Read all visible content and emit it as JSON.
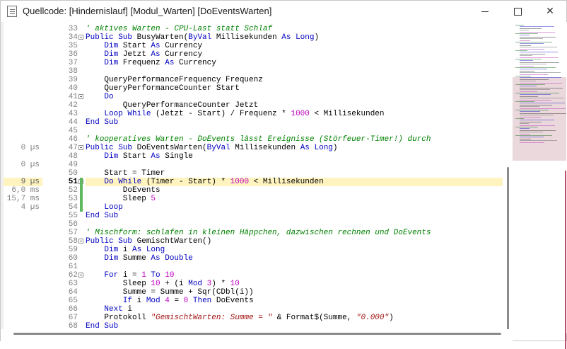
{
  "window": {
    "title": "Quellcode: [Hindernislauf]  [Modul_Warten]  [DoEventsWarten]",
    "min_icon": "minimize-icon",
    "max_icon": "maximize-icon",
    "close_icon": "close-icon",
    "close_glyph": "✕"
  },
  "timings": [
    {
      "line": 47,
      "text": "0 µs"
    },
    {
      "line": 49,
      "text": "0 µs"
    },
    {
      "line": 51,
      "text": "9 µs",
      "highlight": true
    },
    {
      "line": 52,
      "text": "6,0 ms"
    },
    {
      "line": 53,
      "text": "15,7 ms"
    },
    {
      "line": 54,
      "text": "4 µs"
    }
  ],
  "editor": {
    "first_line": 33,
    "active_line": 51,
    "lines": [
      {
        "n": "33",
        "segs": [
          [
            "cm",
            "' aktives Warten - CPU-Last statt Schlaf"
          ]
        ]
      },
      {
        "n": "34",
        "segs": [
          [
            "kw",
            "Public Sub "
          ],
          [
            "",
            "BusyWarten("
          ],
          [
            "kw",
            "ByVal "
          ],
          [
            "",
            "Millisekunden "
          ],
          [
            "kw",
            "As Long"
          ],
          [
            "",
            ")"
          ]
        ],
        "fold": true
      },
      {
        "n": "35",
        "segs": [
          [
            "",
            "    "
          ],
          [
            "kw",
            "Dim "
          ],
          [
            "",
            "Start "
          ],
          [
            "kw",
            "As "
          ],
          [
            "",
            "Currency"
          ]
        ]
      },
      {
        "n": "36",
        "segs": [
          [
            "",
            "    "
          ],
          [
            "kw",
            "Dim "
          ],
          [
            "",
            "Jetzt "
          ],
          [
            "kw",
            "As "
          ],
          [
            "",
            "Currency"
          ]
        ]
      },
      {
        "n": "37",
        "segs": [
          [
            "",
            "    "
          ],
          [
            "kw",
            "Dim "
          ],
          [
            "",
            "Frequenz "
          ],
          [
            "kw",
            "As "
          ],
          [
            "",
            "Currency"
          ]
        ]
      },
      {
        "n": "38",
        "segs": [
          [
            "",
            ""
          ]
        ]
      },
      {
        "n": "39",
        "segs": [
          [
            "",
            "    QueryPerformanceFrequency Frequenz"
          ]
        ]
      },
      {
        "n": "40",
        "segs": [
          [
            "",
            "    QueryPerformanceCounter Start"
          ]
        ]
      },
      {
        "n": "41",
        "segs": [
          [
            "",
            "    "
          ],
          [
            "kw",
            "Do"
          ]
        ],
        "fold": true
      },
      {
        "n": "42",
        "segs": [
          [
            "",
            "        QueryPerformanceCounter Jetzt"
          ]
        ]
      },
      {
        "n": "43",
        "segs": [
          [
            "",
            "    "
          ],
          [
            "kw",
            "Loop While "
          ],
          [
            "",
            "(Jetzt - Start) / Frequenz * "
          ],
          [
            "num",
            "1000"
          ],
          [
            "",
            " < Millisekunden"
          ]
        ]
      },
      {
        "n": "44",
        "segs": [
          [
            "kw",
            "End Sub"
          ]
        ]
      },
      {
        "n": "45",
        "segs": [
          [
            "",
            ""
          ]
        ]
      },
      {
        "n": "46",
        "segs": [
          [
            "cm",
            "' kooperatives Warten - DoEvents lässt Ereignisse (Störfeuer-Timer!) durch"
          ]
        ]
      },
      {
        "n": "47",
        "segs": [
          [
            "kw",
            "Public Sub "
          ],
          [
            "",
            "DoEventsWarten("
          ],
          [
            "kw",
            "ByVal "
          ],
          [
            "",
            "Millisekunden "
          ],
          [
            "kw",
            "As Long"
          ],
          [
            "",
            ")"
          ]
        ],
        "fold": true
      },
      {
        "n": "48",
        "segs": [
          [
            "",
            "    "
          ],
          [
            "kw",
            "Dim "
          ],
          [
            "",
            "Start "
          ],
          [
            "kw",
            "As "
          ],
          [
            "",
            "Single"
          ]
        ]
      },
      {
        "n": "49",
        "segs": [
          [
            "",
            ""
          ]
        ]
      },
      {
        "n": "50",
        "segs": [
          [
            "",
            "    Start = Timer"
          ]
        ]
      },
      {
        "n": "51",
        "segs": [
          [
            "",
            "    "
          ],
          [
            "kw",
            "Do While "
          ],
          [
            "",
            "(Timer - Start) * "
          ],
          [
            "num",
            "1000"
          ],
          [
            "",
            " < Millisekunden"
          ]
        ],
        "fold": true
      },
      {
        "n": "52",
        "segs": [
          [
            "",
            "        DoEvents"
          ]
        ]
      },
      {
        "n": "53",
        "segs": [
          [
            "",
            "        Sleep "
          ],
          [
            "num",
            "5"
          ]
        ]
      },
      {
        "n": "54",
        "segs": [
          [
            "",
            "    "
          ],
          [
            "kw",
            "Loop"
          ]
        ]
      },
      {
        "n": "55",
        "segs": [
          [
            "kw",
            "End Sub"
          ]
        ]
      },
      {
        "n": "56",
        "segs": [
          [
            "",
            ""
          ]
        ]
      },
      {
        "n": "57",
        "segs": [
          [
            "cm",
            "' Mischform: schlafen in kleinen Häppchen, dazwischen rechnen und DoEvents"
          ]
        ]
      },
      {
        "n": "58",
        "segs": [
          [
            "kw",
            "Public Sub "
          ],
          [
            "",
            "GemischtWarten()"
          ]
        ],
        "fold": true
      },
      {
        "n": "59",
        "segs": [
          [
            "",
            "    "
          ],
          [
            "kw",
            "Dim "
          ],
          [
            "",
            "i "
          ],
          [
            "kw",
            "As Long"
          ]
        ]
      },
      {
        "n": "60",
        "segs": [
          [
            "",
            "    "
          ],
          [
            "kw",
            "Dim "
          ],
          [
            "",
            "Summe "
          ],
          [
            "kw",
            "As Double"
          ]
        ]
      },
      {
        "n": "61",
        "segs": [
          [
            "",
            ""
          ]
        ]
      },
      {
        "n": "62",
        "segs": [
          [
            "",
            "    "
          ],
          [
            "kw",
            "For "
          ],
          [
            "",
            "i = "
          ],
          [
            "num",
            "1"
          ],
          [
            " kw",
            " To "
          ],
          [
            "num",
            "10"
          ]
        ],
        "fold": true
      },
      {
        "n": "63",
        "segs": [
          [
            "",
            "        Sleep "
          ],
          [
            "num",
            "10"
          ],
          [
            "",
            " + (i "
          ],
          [
            "kw",
            "Mod "
          ],
          [
            "num",
            "3"
          ],
          [
            "",
            ") * "
          ],
          [
            "num",
            "10"
          ]
        ]
      },
      {
        "n": "64",
        "segs": [
          [
            "",
            "        Summe = Summe + Sqr(CDbl(i))"
          ]
        ]
      },
      {
        "n": "65",
        "segs": [
          [
            "",
            "        "
          ],
          [
            "kw",
            "If "
          ],
          [
            "",
            "i "
          ],
          [
            "kw",
            "Mod "
          ],
          [
            "num",
            "4"
          ],
          [
            "",
            " = "
          ],
          [
            "num",
            "0"
          ],
          [
            " kw",
            " Then "
          ],
          [
            "",
            "DoEvents"
          ]
        ]
      },
      {
        "n": "66",
        "segs": [
          [
            "",
            "    "
          ],
          [
            "kw",
            "Next "
          ],
          [
            "",
            "i"
          ]
        ]
      },
      {
        "n": "67",
        "segs": [
          [
            "",
            "    Protokoll "
          ],
          [
            "str",
            "\"GemischtWarten: Summe = \""
          ],
          [
            "",
            " & Format$(Summe, "
          ],
          [
            "str",
            "\"0.000\""
          ],
          [
            "",
            ")"
          ]
        ]
      },
      {
        "n": "68",
        "segs": [
          [
            "kw",
            "End Sub"
          ]
        ]
      }
    ]
  },
  "colors": {
    "keyword": "#0000c0",
    "comment": "#008000",
    "number": "#c000c0",
    "string": "#a31515",
    "active_line_bg": "#fff3c0",
    "change_bar": "#5fb85f",
    "minimap_view": "#ead8dc"
  }
}
